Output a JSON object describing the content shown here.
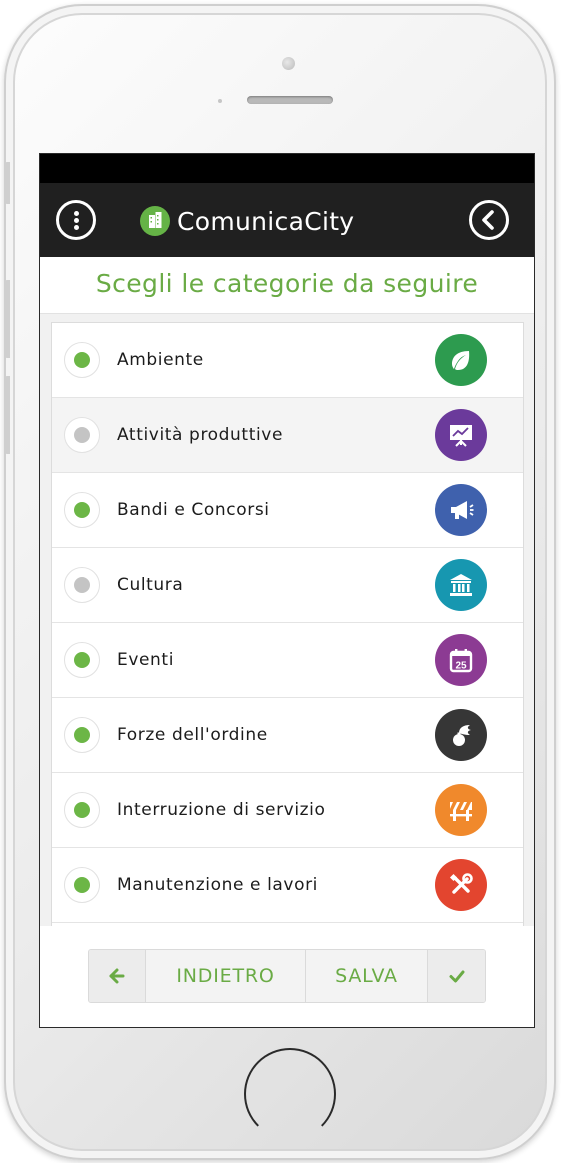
{
  "app": {
    "name": "ComunicaCity"
  },
  "page": {
    "title": "Scegli le categorie da seguire"
  },
  "colors": {
    "accent_green": "#6aab45",
    "selected": "#6cb646",
    "unselected": "#c4c4c4"
  },
  "categories": [
    {
      "label": "Ambiente",
      "selected": true,
      "icon": "leaf-icon",
      "icon_color": "#2d9b4f"
    },
    {
      "label": "Attività produttive",
      "selected": false,
      "icon": "presentation-chart-icon",
      "icon_color": "#6b3a9b"
    },
    {
      "label": "Bandi e Concorsi",
      "selected": true,
      "icon": "megaphone-icon",
      "icon_color": "#3f61ad"
    },
    {
      "label": "Cultura",
      "selected": false,
      "icon": "museum-icon",
      "icon_color": "#1797b0"
    },
    {
      "label": "Eventi",
      "selected": true,
      "icon": "calendar-icon",
      "icon_color": "#8c3b93",
      "icon_text": "25"
    },
    {
      "label": "Forze dell'ordine",
      "selected": true,
      "icon": "police-hat-icon",
      "icon_color": "#363636"
    },
    {
      "label": "Interruzione di servizio",
      "selected": true,
      "icon": "road-barrier-icon",
      "icon_color": "#f0892c"
    },
    {
      "label": "Manutenzione e lavori",
      "selected": true,
      "icon": "tools-icon",
      "icon_color": "#e3452f"
    }
  ],
  "footer": {
    "back_label": "INDIETRO",
    "save_label": "SALVA",
    "back_icon": "arrow-left-icon",
    "confirm_icon": "check-icon"
  }
}
